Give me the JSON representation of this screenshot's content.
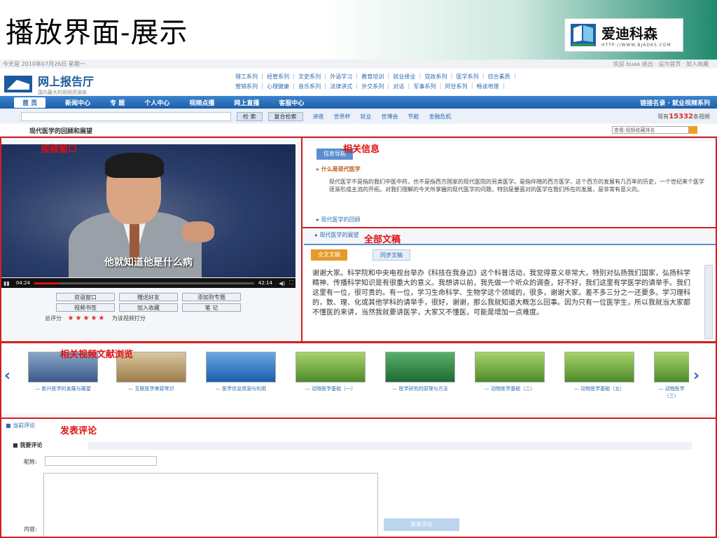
{
  "slide": {
    "title": "播放界面-展示",
    "logo_text": "爱迪科森",
    "logo_url": "HTTP://WWW.BJADKS.COM"
  },
  "site": {
    "top_bar": {
      "date": "今天是 2010年07月26日 星期一",
      "links": "欢迎 buaa 退出 · 设为首页 · 加入收藏"
    },
    "logo_name": "网上报告厅",
    "logo_sub": "国内最大的视频资源库",
    "categories_row1": "理工系列 ｜ 经管系列 ｜ 文史系列 ｜ 外语学习 ｜ 教育培训 ｜ 就业择业 ｜ 党政系列 ｜ 医学系列 ｜ 综合素质 ｜",
    "categories_row2": "营销系列 ｜ 心理健康 ｜ 音乐系列 ｜ 法律讲式 ｜ 外交系列 ｜ 对话 ｜ 军事系列 ｜ 阿甘系列 ｜ 畅谈地理 ｜",
    "nav": [
      "首 页",
      "新闻中心",
      "专 题",
      "个人中心",
      "视频点播",
      "网上直播",
      "客服中心"
    ],
    "nav_right": "链接名录 · 就业视频系列",
    "search": {
      "placeholder": "",
      "btn_search": "检 索",
      "btn_advanced": "复合检索",
      "hot_words": [
        "讲座",
        "世界杯",
        "就业",
        "世博会",
        "节能",
        "金融危机"
      ],
      "count_prefix": "现有",
      "count": "15332",
      "count_suffix": "条视频"
    },
    "crumb": "现代医学的回顾和展望",
    "select_value": "查看:视频收藏排名"
  },
  "annotations": {
    "video": "视频窗口",
    "info": "相关信息",
    "transcript": "全部文稿",
    "related": "相关视频文献浏览",
    "comment": "发表评论"
  },
  "player": {
    "subtitle": "他就知道他是什么病",
    "time_current": "04:24",
    "time_total": "42:14",
    "progress": 0.11,
    "buttons": [
      "双语窗口",
      "赠送好友",
      "添加到专题",
      "视频书签",
      "加入收藏",
      "笔 记"
    ],
    "rating_label": "总评分",
    "rating_stars": 5,
    "rating_hint": "为该视频打分"
  },
  "info": {
    "tab": "信息导航",
    "subtitle": "什么是现代医学",
    "body": "现代医学不是指的我们中医中药，也不是指西方国家的现代医院的另类医学。是指伴随的西方医学，这个西方的发展有几百年的历史，一个世纪来个医学逐渐形成主流的开拓。对我们理解的今天所掌握的现代医学的问题，特别是要面对的医学在我们所在的发展，是非常有意义的。",
    "more": "现代医学的回顾",
    "collapsed": "现代医学的展望"
  },
  "transcript": {
    "tabs": [
      "全文文稿",
      "同步文稿"
    ],
    "text": "谢谢大家。科学院和中央电视台举办《科技在我身边》这个科普活动，我觉得意义非常大，特别对弘扬我们国家，弘扬科学精神、传播科学知识是有很重大的意义。我想讲以前，我先做一个听众的调查，好不好，我们这里有学医学的请举手。我们这里有一位，很可贵的。有一位，学习生命科学、生物学这个领域的，很多，谢谢大家。差不多三分之一还要多。学习理科的，数、理、化或其他学科的请举手，很好，谢谢，那么我就知道大概怎么回事。因为只有一位医学生，所以我就当大家都不懂医的来讲，当然我就要讲医学，大家又不懂医，可能是增加一点难度。"
  },
  "related": [
    {
      "caption": "— 新兴医学的发展与展望"
    },
    {
      "caption": "— 互联医学美容常识"
    },
    {
      "caption": "— 医学信息资源与利用"
    },
    {
      "caption": "— 动物医学基础（一）"
    },
    {
      "caption": "— 医学研究的原理与方法"
    },
    {
      "caption": "— 动物医学基础（二）"
    },
    {
      "caption": "— 动物医学基础（五）"
    },
    {
      "caption": "— 动物医学（三）"
    }
  ],
  "comment": {
    "section": "当前评论",
    "subhead": "我要评论",
    "nickname_label": "昵称:",
    "content_label": "内容:",
    "submit": "发表评论"
  },
  "colors": {
    "annotation_red": "#d42020",
    "nav_blue": "#1f5fa8",
    "brand_green": "#1f8a6e"
  }
}
